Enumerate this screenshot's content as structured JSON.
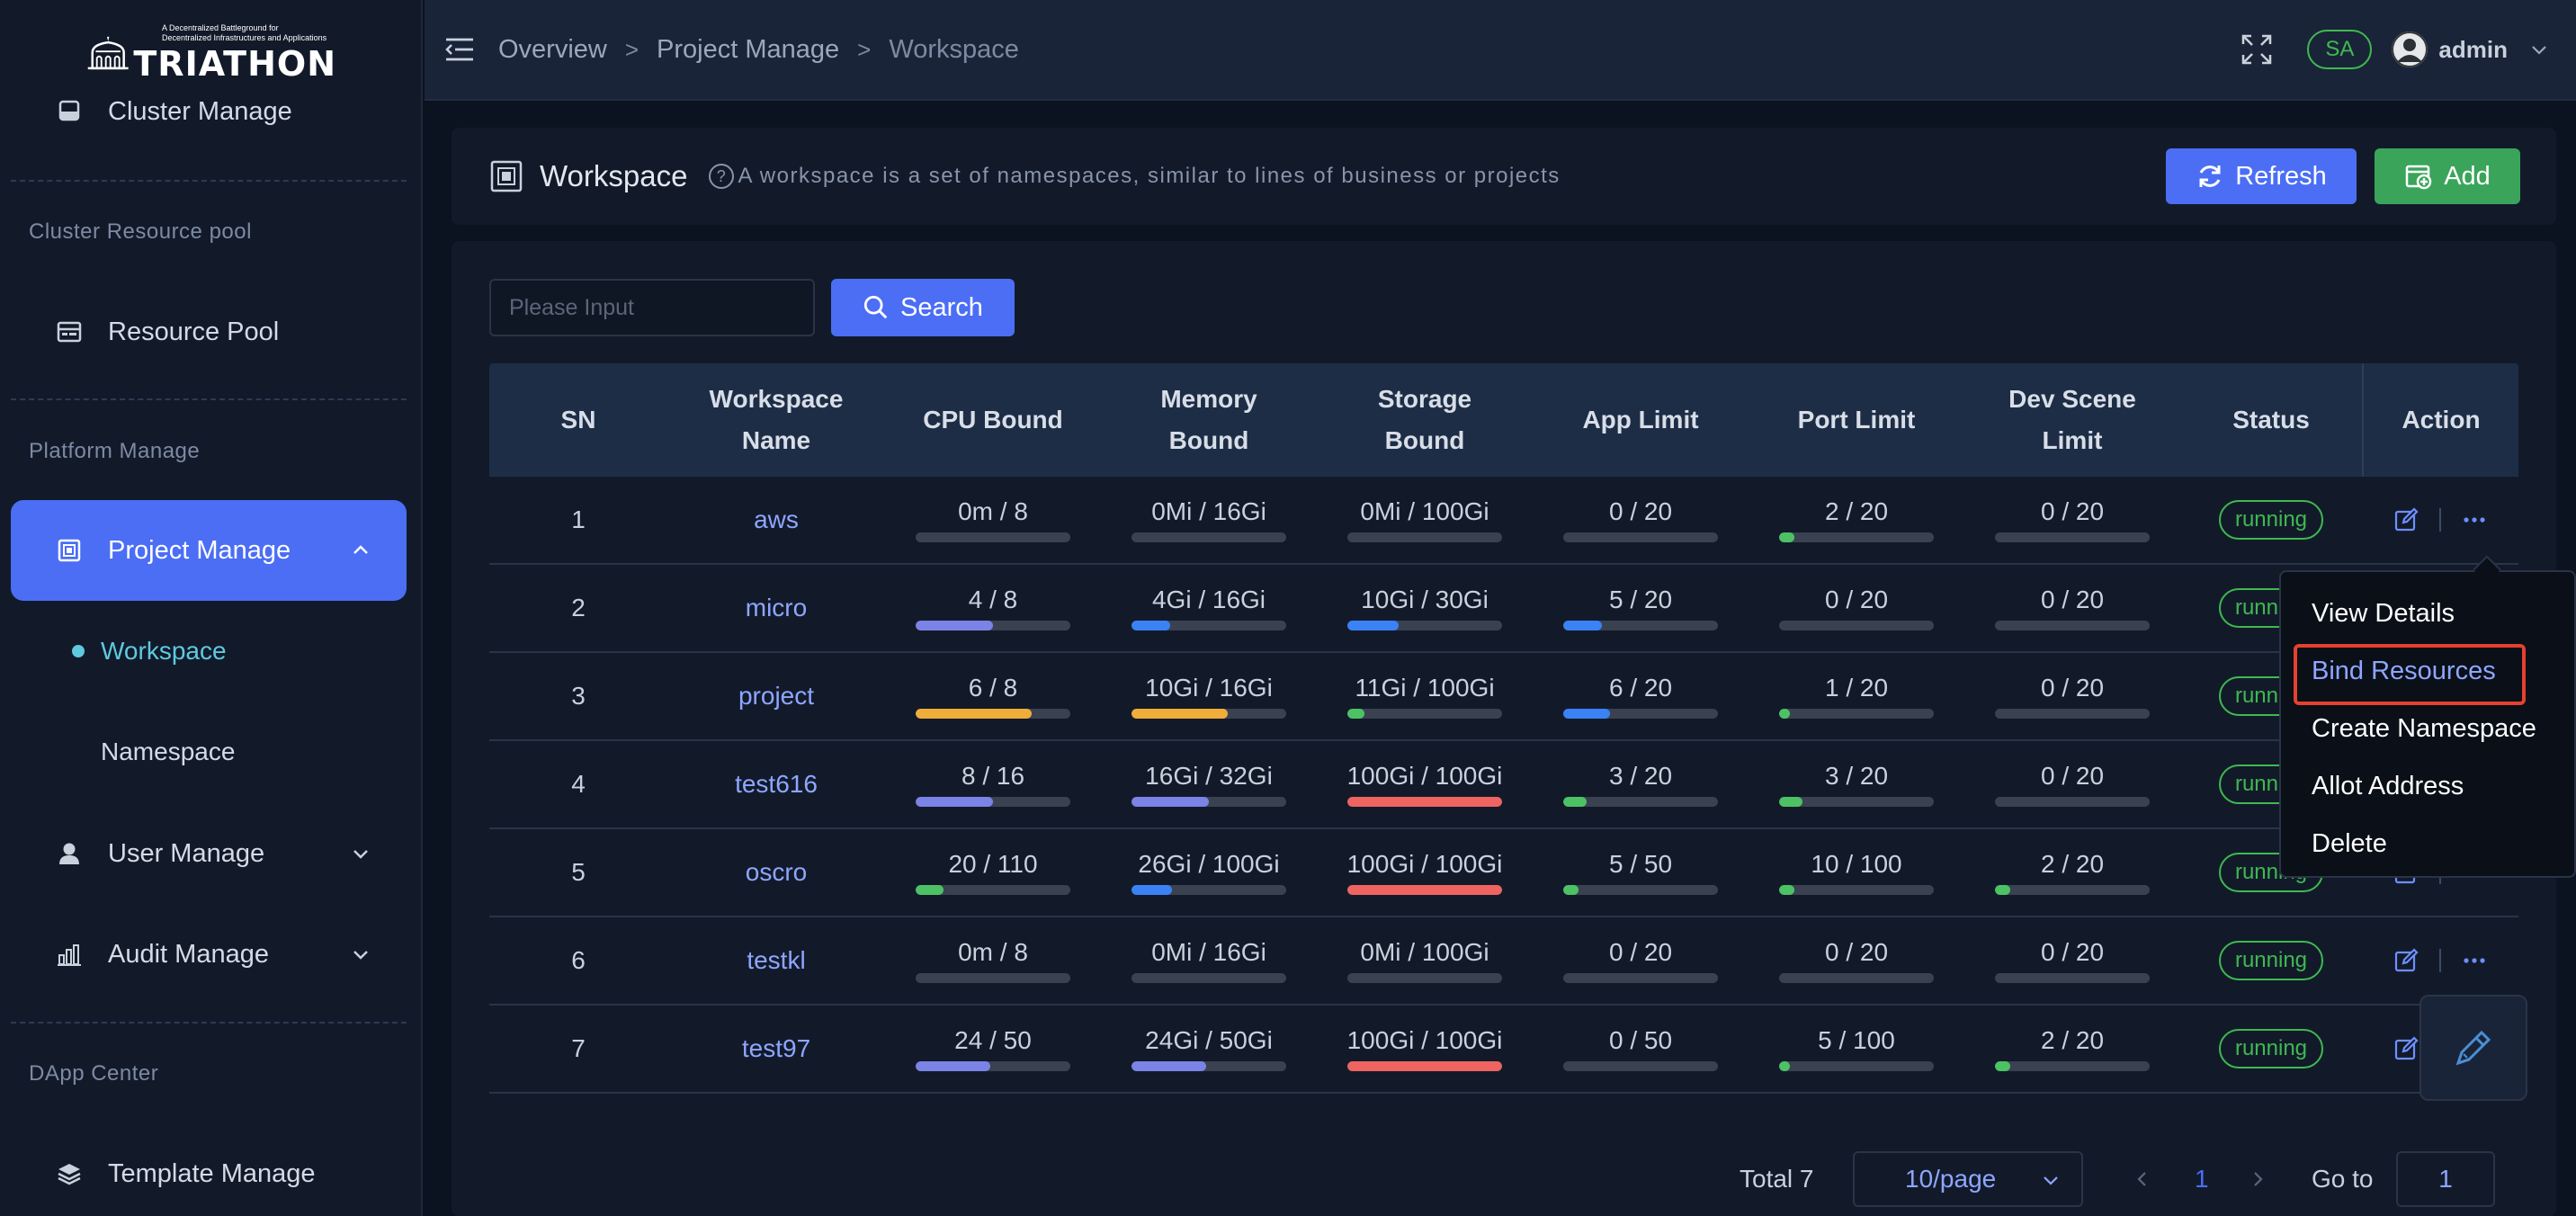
{
  "brand": {
    "name": "TRIATHON",
    "tagline_line1": "A Decentralized Battleground for",
    "tagline_line2": "Decentralized Infrastructures and Applications"
  },
  "sidebar": {
    "cluster_manage": "Cluster Manage",
    "section_resource_pool": "Cluster Resource pool",
    "resource_pool": "Resource Pool",
    "section_platform": "Platform Manage",
    "project_manage": "Project Manage",
    "workspace": "Workspace",
    "namespace": "Namespace",
    "user_manage": "User Manage",
    "audit_manage": "Audit Manage",
    "section_dapp": "DApp Center",
    "template_manage": "Template Manage"
  },
  "header": {
    "breadcrumb": [
      "Overview",
      "Project Manage",
      "Workspace"
    ],
    "sa_badge": "SA",
    "user": "admin"
  },
  "page": {
    "title": "Workspace",
    "hint": "A workspace is a set of namespaces, similar to lines of business or projects",
    "refresh_label": "Refresh",
    "add_label": "Add"
  },
  "search": {
    "placeholder": "Please Input",
    "button_label": "Search"
  },
  "table": {
    "headers": {
      "sn": "SN",
      "name_l1": "Workspace",
      "name_l2": "Name",
      "cpu": "CPU Bound",
      "mem_l1": "Memory",
      "mem_l2": "Bound",
      "sto_l1": "Storage",
      "sto_l2": "Bound",
      "app": "App Limit",
      "port": "Port Limit",
      "dev_l1": "Dev Scene",
      "dev_l2": "Limit",
      "status": "Status",
      "action": "Action"
    },
    "rows": [
      {
        "sn": "1",
        "name": "aws",
        "cpu": "0m / 8",
        "cpu_pct": 0,
        "mem": "0Mi / 16Gi",
        "mem_pct": 0,
        "sto": "0Mi / 100Gi",
        "sto_pct": 0,
        "app": "0 / 20",
        "app_pct": 0,
        "port": "2 / 20",
        "port_pct": 10,
        "dev": "0 / 20",
        "dev_pct": 0,
        "status": "running"
      },
      {
        "sn": "2",
        "name": "micro",
        "cpu": "4 / 8",
        "cpu_pct": 50,
        "mem": "4Gi / 16Gi",
        "mem_pct": 25,
        "sto": "10Gi / 30Gi",
        "sto_pct": 33,
        "app": "5 / 20",
        "app_pct": 25,
        "port": "0 / 20",
        "port_pct": 0,
        "dev": "0 / 20",
        "dev_pct": 0,
        "status": "running"
      },
      {
        "sn": "3",
        "name": "project",
        "cpu": "6 / 8",
        "cpu_pct": 75,
        "mem": "10Gi / 16Gi",
        "mem_pct": 62,
        "sto": "11Gi / 100Gi",
        "sto_pct": 11,
        "app": "6 / 20",
        "app_pct": 30,
        "port": "1 / 20",
        "port_pct": 5,
        "dev": "0 / 20",
        "dev_pct": 0,
        "status": "running"
      },
      {
        "sn": "4",
        "name": "test616",
        "cpu": "8 / 16",
        "cpu_pct": 50,
        "mem": "16Gi / 32Gi",
        "mem_pct": 50,
        "sto": "100Gi / 100Gi",
        "sto_pct": 100,
        "app": "3 / 20",
        "app_pct": 15,
        "port": "3 / 20",
        "port_pct": 15,
        "dev": "0 / 20",
        "dev_pct": 0,
        "status": "running"
      },
      {
        "sn": "5",
        "name": "oscro",
        "cpu": "20 / 110",
        "cpu_pct": 18,
        "mem": "26Gi / 100Gi",
        "mem_pct": 26,
        "sto": "100Gi / 100Gi",
        "sto_pct": 100,
        "app": "5 / 50",
        "app_pct": 10,
        "port": "10 / 100",
        "port_pct": 10,
        "dev": "2 / 20",
        "dev_pct": 10,
        "status": "running"
      },
      {
        "sn": "6",
        "name": "testkl",
        "cpu": "0m / 8",
        "cpu_pct": 0,
        "mem": "0Mi / 16Gi",
        "mem_pct": 0,
        "sto": "0Mi / 100Gi",
        "sto_pct": 0,
        "app": "0 / 20",
        "app_pct": 0,
        "port": "0 / 20",
        "port_pct": 0,
        "dev": "0 / 20",
        "dev_pct": 0,
        "status": "running"
      },
      {
        "sn": "7",
        "name": "test97",
        "cpu": "24 / 50",
        "cpu_pct": 48,
        "mem": "24Gi / 50Gi",
        "mem_pct": 48,
        "sto": "100Gi / 100Gi",
        "sto_pct": 100,
        "app": "0 / 50",
        "app_pct": 0,
        "port": "5 / 100",
        "port_pct": 5,
        "dev": "2 / 20",
        "dev_pct": 10,
        "status": "running"
      }
    ]
  },
  "colors": {
    "accent": "#4b6ef5",
    "success": "#3fb950",
    "bar_purple": "#7b83e6",
    "bar_blue": "#3b82f6",
    "bar_orange": "#f0ad3a",
    "bar_red": "#ef6461",
    "bar_green": "#4cc264",
    "highlight_border": "#e5412f"
  },
  "pagination": {
    "total": "Total 7",
    "page_size": "10/page",
    "current_page": "1",
    "goto_label": "Go to",
    "goto_value": "1"
  },
  "action_menu": {
    "items": [
      "View Details",
      "Bind Resources",
      "Create Namespace",
      "Allot Address",
      "Delete"
    ],
    "highlighted": "Bind Resources"
  },
  "icons": [
    "menu-fold-icon",
    "fullscreen-icon",
    "user-avatar-icon",
    "chevron-down-icon",
    "server-icon",
    "resource-pool-icon",
    "project-icon",
    "user-icon",
    "audit-icon",
    "template-icon",
    "refresh-icon",
    "add-icon",
    "search-icon",
    "edit-icon",
    "more-icon",
    "pen-icon"
  ]
}
